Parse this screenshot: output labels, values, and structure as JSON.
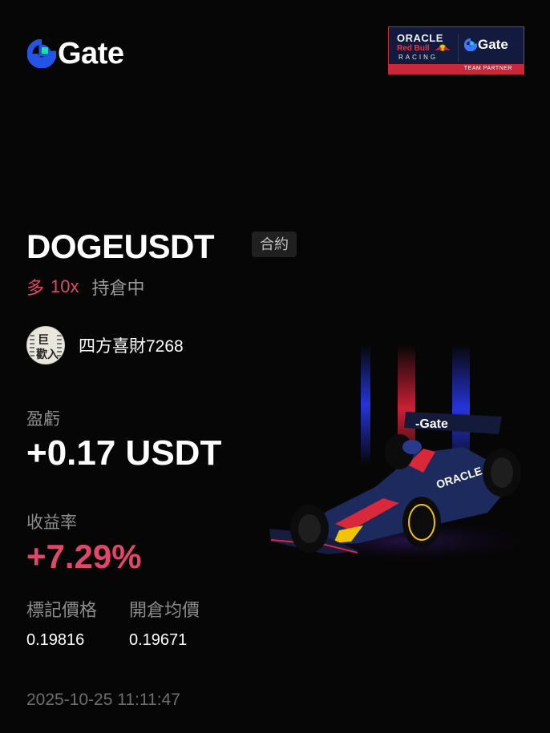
{
  "brand": {
    "name": "Gate",
    "icon": "gate-logo-icon"
  },
  "partner": {
    "oracle": "ORACLE",
    "redbull": "Red Bull",
    "racing": "RACING",
    "gate": "Gate",
    "tag": "TEAM PARTNER"
  },
  "position": {
    "symbol": "DOGEUSDT",
    "type_badge": "合約",
    "side": "多",
    "leverage": "10x",
    "status": "持倉中"
  },
  "user": {
    "name": "四方喜財7268",
    "avatar_text_top": "巨",
    "avatar_text_bottom": "歡入"
  },
  "pnl": {
    "label": "盈虧",
    "value": "+0.17 USDT"
  },
  "roi": {
    "label": "收益率",
    "value": "+7.29%"
  },
  "prices": {
    "mark_label": "標記價格",
    "mark_value": "0.19816",
    "entry_label": "開倉均價",
    "entry_value": "0.19671"
  },
  "timestamp": "2025-10-25 11:11:47",
  "colors": {
    "profit": "#e0476a",
    "brand_blue": "#2354e6",
    "brand_green": "#17e6a1",
    "background": "#060606"
  },
  "car_livery": "-Gate"
}
